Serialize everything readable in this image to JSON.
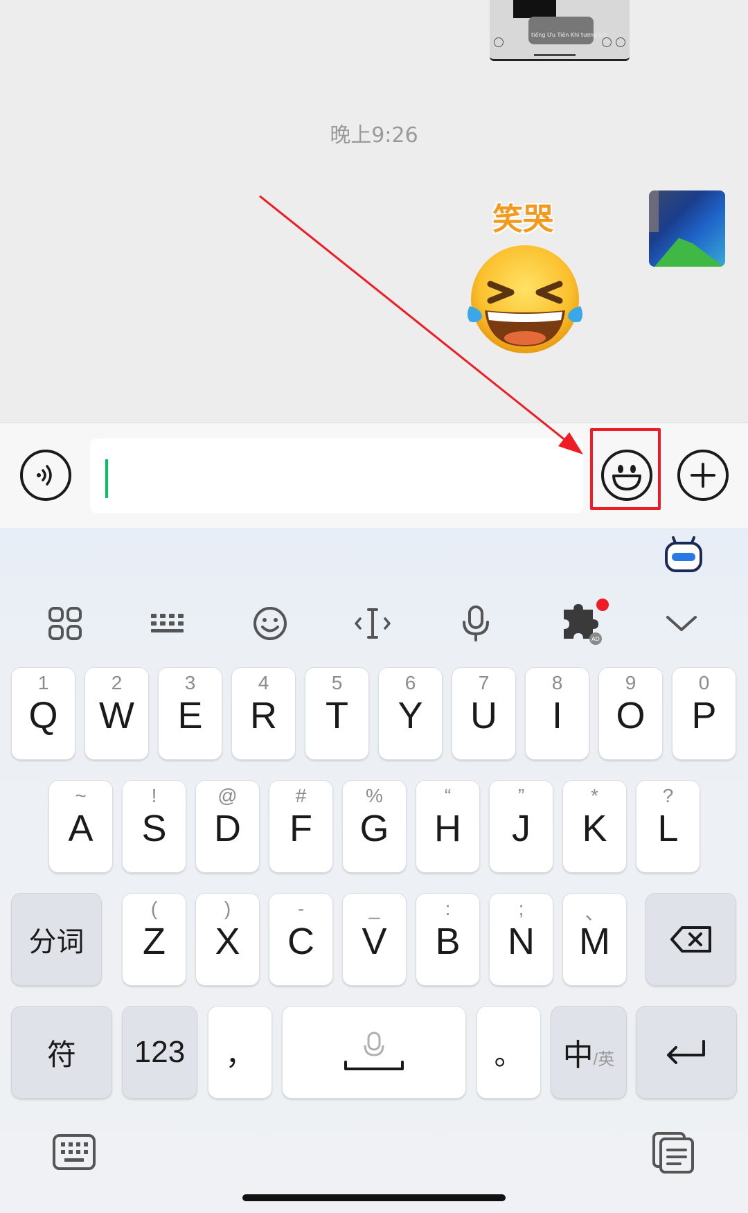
{
  "chat": {
    "screenshot_text": "tiếng Ưu Tiên Khi tương ích",
    "timestamp": "晚上9:26",
    "sticker_caption": "笑哭"
  },
  "input_bar": {
    "text_value": "",
    "voice_button": "voice-wave-icon",
    "emoji_button": "smiley-face-icon",
    "more_button": "plus-icon"
  },
  "annotation": {
    "color": "#ee1c25"
  },
  "keyboard": {
    "toolbar": [
      {
        "id": "apps",
        "icon": "grid-icon"
      },
      {
        "id": "layout",
        "icon": "keyboard-layout-icon"
      },
      {
        "id": "emoji",
        "icon": "emoji-icon"
      },
      {
        "id": "cursor",
        "icon": "cursor-move-icon"
      },
      {
        "id": "voice",
        "icon": "microphone-icon"
      },
      {
        "id": "plugin",
        "icon": "puzzle-icon",
        "badge": "AD"
      },
      {
        "id": "collapse",
        "icon": "chevron-down-icon"
      }
    ],
    "row1": [
      {
        "key": "Q",
        "hint": "1"
      },
      {
        "key": "W",
        "hint": "2"
      },
      {
        "key": "E",
        "hint": "3"
      },
      {
        "key": "R",
        "hint": "4"
      },
      {
        "key": "T",
        "hint": "5"
      },
      {
        "key": "Y",
        "hint": "6"
      },
      {
        "key": "U",
        "hint": "7"
      },
      {
        "key": "I",
        "hint": "8"
      },
      {
        "key": "O",
        "hint": "9"
      },
      {
        "key": "P",
        "hint": "0"
      }
    ],
    "row2": [
      {
        "key": "A",
        "hint": "~"
      },
      {
        "key": "S",
        "hint": "!"
      },
      {
        "key": "D",
        "hint": "@"
      },
      {
        "key": "F",
        "hint": "#"
      },
      {
        "key": "G",
        "hint": "%"
      },
      {
        "key": "H",
        "hint": "“"
      },
      {
        "key": "J",
        "hint": "”"
      },
      {
        "key": "K",
        "hint": "*"
      },
      {
        "key": "L",
        "hint": "?"
      }
    ],
    "row3": [
      {
        "key": "Z",
        "hint": "("
      },
      {
        "key": "X",
        "hint": ")"
      },
      {
        "key": "C",
        "hint": "-"
      },
      {
        "key": "V",
        "hint": "_"
      },
      {
        "key": "B",
        "hint": ":"
      },
      {
        "key": "N",
        "hint": ";"
      },
      {
        "key": "M",
        "hint": "、"
      }
    ],
    "segment_label": "分词",
    "symbol_label": "符",
    "number_label": "123",
    "comma_label": "，",
    "period_label": "。",
    "lang_main": "中",
    "lang_sub": "/英"
  }
}
